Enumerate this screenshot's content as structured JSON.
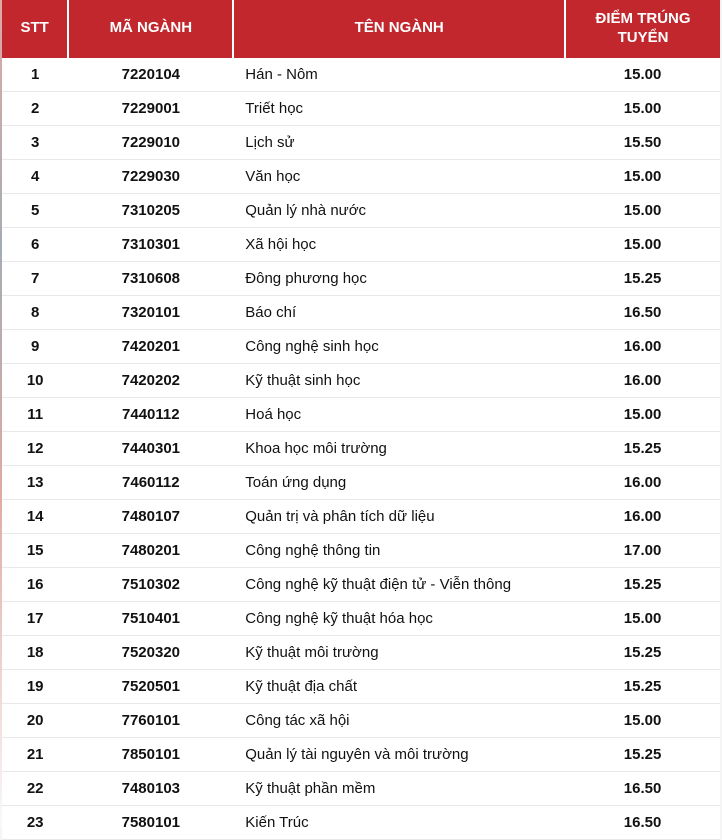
{
  "table": {
    "headers": {
      "stt": "STT",
      "code": "MÃ NGÀNH",
      "name": "TÊN NGÀNH",
      "score": "ĐIỂM TRÚNG TUYỂN"
    },
    "rows": [
      {
        "stt": "1",
        "code": "7220104",
        "name": "Hán - Nôm",
        "score": "15.00"
      },
      {
        "stt": "2",
        "code": "7229001",
        "name": "Triết học",
        "score": "15.00"
      },
      {
        "stt": "3",
        "code": "7229010",
        "name": "Lịch sử",
        "score": "15.50"
      },
      {
        "stt": "4",
        "code": "7229030",
        "name": "Văn học",
        "score": "15.00"
      },
      {
        "stt": "5",
        "code": "7310205",
        "name": "Quản lý nhà nước",
        "score": "15.00"
      },
      {
        "stt": "6",
        "code": "7310301",
        "name": "Xã hội học",
        "score": "15.00"
      },
      {
        "stt": "7",
        "code": "7310608",
        "name": "Đông phương học",
        "score": "15.25"
      },
      {
        "stt": "8",
        "code": "7320101",
        "name": "Báo chí",
        "score": "16.50"
      },
      {
        "stt": "9",
        "code": "7420201",
        "name": "Công nghệ sinh học",
        "score": "16.00"
      },
      {
        "stt": "10",
        "code": "7420202",
        "name": "Kỹ thuật sinh học",
        "score": "16.00"
      },
      {
        "stt": "11",
        "code": "7440112",
        "name": "Hoá học",
        "score": "15.00"
      },
      {
        "stt": "12",
        "code": "7440301",
        "name": "Khoa học môi trường",
        "score": "15.25"
      },
      {
        "stt": "13",
        "code": "7460112",
        "name": "Toán ứng dụng",
        "score": "16.00"
      },
      {
        "stt": "14",
        "code": "7480107",
        "name": "Quản trị và phân tích dữ liệu",
        "score": "16.00"
      },
      {
        "stt": "15",
        "code": "7480201",
        "name": "Công nghệ thông tin",
        "score": "17.00"
      },
      {
        "stt": "16",
        "code": "7510302",
        "name": "Công nghệ kỹ thuật điện tử - Viễn thông",
        "score": "15.25"
      },
      {
        "stt": "17",
        "code": "7510401",
        "name": "Công nghệ kỹ thuật hóa học",
        "score": "15.00"
      },
      {
        "stt": "18",
        "code": "7520320",
        "name": "Kỹ thuật môi trường",
        "score": "15.25"
      },
      {
        "stt": "19",
        "code": "7520501",
        "name": "Kỹ thuật địa chất",
        "score": "15.25"
      },
      {
        "stt": "20",
        "code": "7760101",
        "name": "Công tác xã hội",
        "score": "15.00"
      },
      {
        "stt": "21",
        "code": "7850101",
        "name": "Quản lý tài nguyên và môi trường",
        "score": "15.25"
      },
      {
        "stt": "22",
        "code": "7480103",
        "name": "Kỹ thuật phần mềm",
        "score": "16.50"
      },
      {
        "stt": "23",
        "code": "7580101",
        "name": "Kiến Trúc",
        "score": "16.50"
      }
    ]
  }
}
